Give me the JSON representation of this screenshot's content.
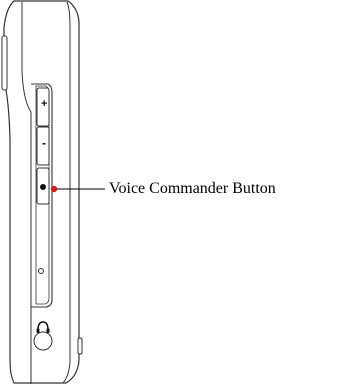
{
  "callout": {
    "label": "Voice Commander Button",
    "color": "#e01a1a"
  },
  "buttons": {
    "volume_up_symbol": "+",
    "volume_down_symbol": "-"
  },
  "icons": {
    "headphone": "headphone-icon",
    "voice": "voice-commander-dot-icon"
  },
  "colors": {
    "outline": "#333333",
    "line": "#000000",
    "background": "#ffffff"
  }
}
